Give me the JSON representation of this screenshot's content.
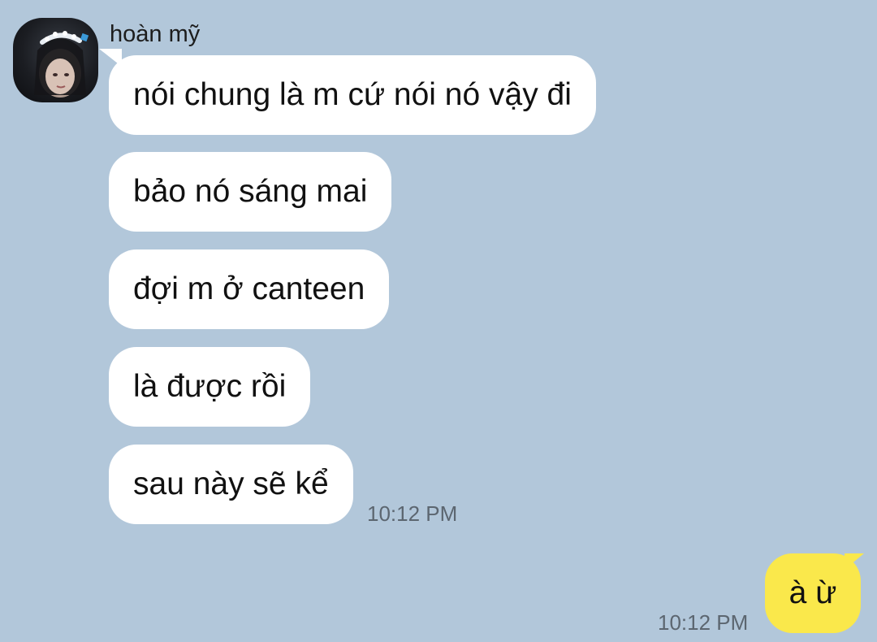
{
  "contact": {
    "name": "hoàn mỹ",
    "avatar": "profile-photo"
  },
  "incoming_messages": [
    {
      "text": "nói chung là m cứ nói nó vậy đi"
    },
    {
      "text": "bảo nó sáng mai"
    },
    {
      "text": "đợi m ở canteen"
    },
    {
      "text": "là được rồi"
    },
    {
      "text": "sau này sẽ kể"
    }
  ],
  "incoming_time": "10:12 PM",
  "outgoing_message": {
    "text": "à ừ",
    "time": "10:12 PM"
  },
  "colors": {
    "background": "#b2c7da",
    "incoming_bubble": "#ffffff",
    "outgoing_bubble": "#fae84b",
    "timestamp": "#5c6670"
  }
}
